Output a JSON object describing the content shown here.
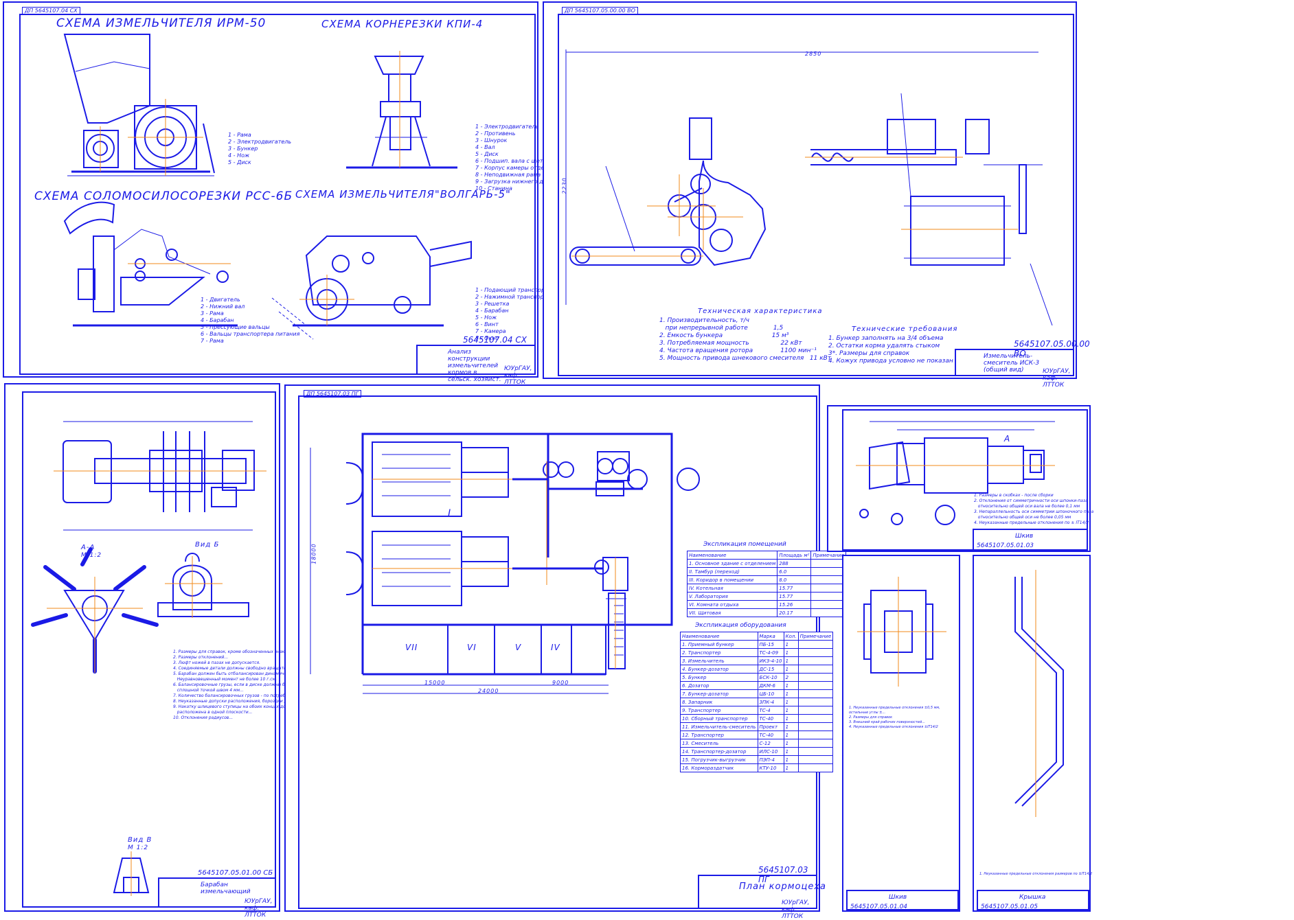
{
  "sheet1": {
    "corner_code": "ДП 5645107.04 СХ",
    "titles": {
      "irm": "СХЕМА ИЗМЕЛЬЧИТЕЛЯ  ИРМ-50",
      "kpi": "СХЕМА КОРНЕРЕЗКИ КПИ-4",
      "rss": "СХЕМА СОЛОМОСИЛОСОРЕЗКИ  РСС-6Б",
      "volgar": "СХЕМА ИЗМЕЛЬЧИТЕЛЯ\"ВОЛГАРЬ-5\""
    },
    "legend_irm": "1 - Рама\n2 - Электродвигатель\n3 - Бункер\n4 - Нож\n5 - Диск",
    "legend_kpi": "1 - Электродвигатель\n2 - Противень\n3 - Шнурок\n4 - Вал\n5 - Диск\n6 - Подшип. вала с щеткой\n7 - Корпус камеры отделителя\n8 - Неподвижная рама\n9 - Загрузка нижнего диска\n10 - Станина",
    "legend_rss": "1 - Двигатель\n2 - Нижний вал\n3 - Рама\n4 - Барабан\n5 - Прессующие вальцы\n6 - Вальцы транспортера питания\n7 - Рама",
    "legend_volgar": "1 - Подающий транспортер\n2 - Нажимной транспортер\n3 - Решетка\n4 - Барабан\n5 - Нож\n6 - Винт\n7 - Камера\n8 - Окно",
    "stamp_code": "5645107.04 СХ",
    "stamp_name": "Анализ конструкции измельчителей кормов в сельск. хозяйст.",
    "stamp_org": "ЮУрГАУ, каф. ЛТТОК"
  },
  "sheet2": {
    "corner_code": "ДП 5645107.05.00.00 ВО",
    "tech_title": "Техническая характеристика",
    "tech_lines": "1. Производительность, т/ч\n   при непрерывной работе             1,5\n2. Емкость бункера                         15 м³\n3. Потребляемая мощность                22 кВт\n4. Частота вращения ротора              1100 мин⁻¹\n5. Мощность привода шнекового смесителя   11 кВт",
    "req_title": "Технические требования",
    "req_lines": "1. Бункер заполнять на 3/4 объема\n2. Остатки корма удалять стыком\n3*. Размеры для справок\n4. Кожух привода условно не показан на чертеже",
    "dim_h": "2850",
    "dim_v": "2230",
    "stamp_code": "5645107.05.00.00 ВО",
    "stamp_name": "Измельчитель-смеситель ИСК-3 (общий вид)",
    "stamp_org": "ЮУрГАУ, каф. ЛТТОК"
  },
  "sheet3": {
    "corner_code": "ДП 5645107.05.01.00",
    "section_aa": "А-А",
    "section_aa_scale": "М 1:2",
    "view_b": "Вид Б",
    "view_v": "Вид В",
    "view_v_scale": "М 1:2",
    "notes": "1. Размеры для справок, кроме обозначенных знаком...\n2. Размеры отклонений...\n3. Люфт ножей в пазах не допускается.\n4. Соединяемые детали должны свободно вращаться в подшипниках.\n5. Барабан должен быть отбалансирован динамически.\n   Неуравновешенный момент не более 10 г.см.\n6. Балансировочные грузы, если в диске должны быть приварены\n   сплошной точкой швом 4 мм...\n7. Количество балансировочных грузов - по потребности.\n8. Неуказанные допуски расположения, бороздки для шкива.\n9. Накатку шлицевого ступицы на обоих концах должна быть\n   расположена в одной плоскости...\n10. Отклонения радиусов...",
    "stamp_code": "5645107.05.01.00 СБ",
    "stamp_name": "Барабан измельчающий",
    "stamp_org": "ЮУрГАУ, каф. ЛТТОК"
  },
  "sheet4": {
    "corner_code": "ДП 5645107.03 ПГ",
    "rooms": [
      "I",
      "VII",
      "VI",
      "V",
      "IV"
    ],
    "dim_bottom": "24000",
    "dim_a": "15000",
    "dim_b": "9000",
    "dim_left": "18000",
    "premises_title": "Экспликация помещений",
    "premises_header": [
      "Наименование",
      "Площадь м²",
      "Примечание"
    ],
    "premises_rows": [
      [
        "1. Основное здание с отделением",
        "288",
        ""
      ],
      [
        "II. Тамбур (переход)",
        "6.0",
        ""
      ],
      [
        "III. Коридор в помещении",
        "8.0",
        ""
      ],
      [
        "IV. Котельная",
        "15.77",
        ""
      ],
      [
        "V. Лаборатория",
        "15.77",
        ""
      ],
      [
        "VI. Комната отдыха",
        "15.26",
        ""
      ],
      [
        "VII. Щитовая",
        "20.17",
        ""
      ]
    ],
    "equip_title": "Экспликация оборудования",
    "equip_header": [
      "Наименование",
      "Марка",
      "Кол.",
      "Примечание"
    ],
    "equip_rows": [
      [
        "1. Приемный бункер",
        "ПБ-15",
        "1",
        ""
      ],
      [
        "2. Транспортер",
        "ТС-4-09",
        "1",
        ""
      ],
      [
        "3. Измельчитель",
        "ИКЗ-4-10",
        "1",
        ""
      ],
      [
        "4. Бункер-дозатор",
        "ДС-15",
        "1",
        ""
      ],
      [
        "5. Бункер",
        "БСК-10",
        "2",
        ""
      ],
      [
        "6. Дозатор",
        "ДКМ-6",
        "1",
        ""
      ],
      [
        "7. Бункер-дозатор",
        "ЦБ-10",
        "1",
        ""
      ],
      [
        "8. Запарник",
        "ЗПК-4",
        "1",
        ""
      ],
      [
        "9. Транспортер",
        "ТС-4",
        "1",
        ""
      ],
      [
        "10. Сборный транспортер",
        "ТС-40",
        "1",
        ""
      ],
      [
        "11. Измельчитель-смеситель",
        "Проект",
        "1",
        ""
      ],
      [
        "12. Транспортер",
        "ТС-40",
        "1",
        ""
      ],
      [
        "13. Смеситель",
        "С-12",
        "1",
        ""
      ],
      [
        "14. Транспортер-дозатор",
        "ИЛС-10",
        "1",
        ""
      ],
      [
        "15. Погрузчик-выгрузчик",
        "ПЭП-4",
        "1",
        ""
      ],
      [
        "16. Кормораздатчик",
        "КТУ-10",
        "1",
        ""
      ]
    ],
    "stamp_code": "5645107.03 ПГ",
    "stamp_name": "План кормоцеха",
    "stamp_org": "ЮУрГАУ, каф. ЛТТОК"
  },
  "sheet5": {
    "section_label": "А",
    "notes": "1. Размеры в скобках - после сборки\n2. Отклонения от симметричности оси шпонки-паза\n   относительно общей оси вала не более 0,1 мм\n3. Непараллельность оси симметрии шпоночного паза\n   относительно общей оси не более 0,05 мм\n4. Неуказанные предельные отклонения по ± IT14/2",
    "stamp_name": "Шкив",
    "stamp_code": "5645107.05.01.03"
  },
  "sheet6": {
    "notes": "1. Неуказанные предельные отклонения ±0,5 мм, остальные углы ±...\n2. Размеры для справок\n3. Внешний край рабочих поверхностей...\n4. Неуказанные предельные отклонения ±IT14/2",
    "stamp_name": "Шкив",
    "stamp_code": "5645107.05.01.04"
  },
  "sheet7": {
    "notes": "1. Неуказанные предельные отклонения размеров по ±IT14/2",
    "stamp_name": "Крышка",
    "stamp_code": "5645107.05.01.05"
  }
}
